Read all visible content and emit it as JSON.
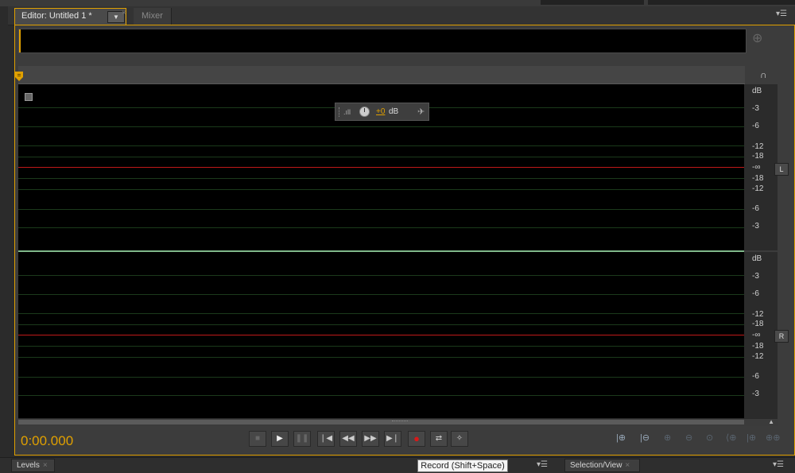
{
  "tabs": [
    {
      "label": "Editor: Untitled 1 *",
      "active": true
    },
    {
      "label": "Mixer",
      "active": false
    }
  ],
  "panel_menu_icon": "panel-menu-icon",
  "hud": {
    "value": "+0",
    "unit": "dB"
  },
  "scale": {
    "top": [
      "dB",
      "-3",
      "-6",
      "-12",
      "-18",
      "-∞",
      "-18",
      "-12",
      "-6",
      "-3"
    ],
    "bottom": [
      "dB",
      "-3",
      "-6",
      "-12",
      "-18",
      "-∞",
      "-18",
      "-12",
      "-6",
      "-3"
    ]
  },
  "channels": {
    "left": "L",
    "right": "R"
  },
  "transport": {
    "time": "0:00.000",
    "buttons": [
      "stop",
      "play",
      "pause",
      "go-to-start",
      "rewind",
      "fast-forward",
      "go-to-end",
      "record",
      "loop",
      "skip-selection"
    ]
  },
  "tooltip": "Record (Shift+Space)",
  "bottom_panels": [
    {
      "label": "Levels"
    },
    {
      "label": "Selection/View"
    }
  ],
  "colors": {
    "accent": "#e0a000",
    "zero_line": "#c01818",
    "grid": "#1b3a1b",
    "record": "#d61a1a"
  }
}
